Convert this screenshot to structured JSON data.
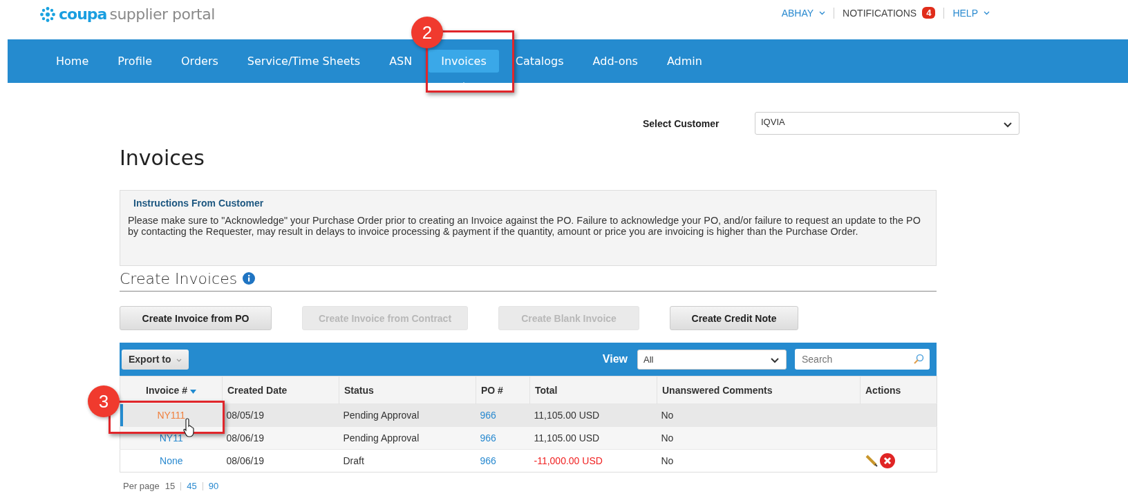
{
  "header": {
    "logo_brand": "coupa",
    "logo_product": "supplier portal",
    "user_menu": "ABHAY",
    "notifications": {
      "label": "NOTIFICATIONS",
      "count": "4"
    },
    "help_menu": "HELP"
  },
  "nav": [
    {
      "label": "Home",
      "selected": false
    },
    {
      "label": "Profile",
      "selected": false
    },
    {
      "label": "Orders",
      "selected": false
    },
    {
      "label": "Service/Time Sheets",
      "selected": false
    },
    {
      "label": "ASN",
      "selected": false
    },
    {
      "label": "Invoices",
      "selected": true
    },
    {
      "label": "Catalogs",
      "selected": false
    },
    {
      "label": "Add-ons",
      "selected": false
    },
    {
      "label": "Admin",
      "selected": false
    }
  ],
  "customer_select": {
    "label": "Select Customer",
    "value": "IQVIA"
  },
  "title": "Invoices",
  "instructions": {
    "title": "Instructions From Customer",
    "text": "Please make sure to \"Acknowledge\" your Purchase Order prior to creating an Invoice against the PO. Failure to acknowledge your PO, and/or failure to request an update to the PO by contacting the Requester, may result in delays to invoice processing & payment if the quantity, amount or price you are invoicing is higher than the Purchase Order."
  },
  "create_section": {
    "title": "Create Invoices"
  },
  "buttons": [
    {
      "label": "Create Invoice from PO",
      "disabled": false
    },
    {
      "label": "Create Invoice from Contract",
      "disabled": true
    },
    {
      "label": "Create Blank Invoice",
      "disabled": true
    },
    {
      "label": "Create Credit Note",
      "disabled": false
    }
  ],
  "table": {
    "export_button": "Export to",
    "view_label": "View",
    "view_value": "All",
    "search": {
      "placeholder": "Search"
    },
    "columns": [
      "Invoice #",
      "Created Date",
      "Status",
      "PO #",
      "Total",
      "Unanswered Comments",
      "Actions"
    ],
    "rows": [
      {
        "invoice": "NY111",
        "created": "08/05/19",
        "status": "Pending Approval",
        "po": "966",
        "total": "11,105.00 USD",
        "negative": false,
        "comments": "No",
        "editable": false,
        "deletable": false,
        "selected": true
      },
      {
        "invoice": "NY11",
        "created": "08/06/19",
        "status": "Pending Approval",
        "po": "966",
        "total": "11,105.00 USD",
        "negative": false,
        "comments": "No",
        "editable": false,
        "deletable": false,
        "selected": false
      },
      {
        "invoice": "None",
        "created": "08/06/19",
        "status": "Draft",
        "po": "966",
        "total": "-11,000.00 USD",
        "negative": true,
        "comments": "No",
        "editable": true,
        "deletable": true,
        "selected": false
      }
    ]
  },
  "pagination": {
    "label": "Per page",
    "options": [
      {
        "label": "15",
        "selected": true
      },
      {
        "label": "45",
        "selected": false
      },
      {
        "label": "90",
        "selected": false
      }
    ]
  },
  "callouts": [
    {
      "number": "2"
    },
    {
      "number": "3"
    }
  ]
}
